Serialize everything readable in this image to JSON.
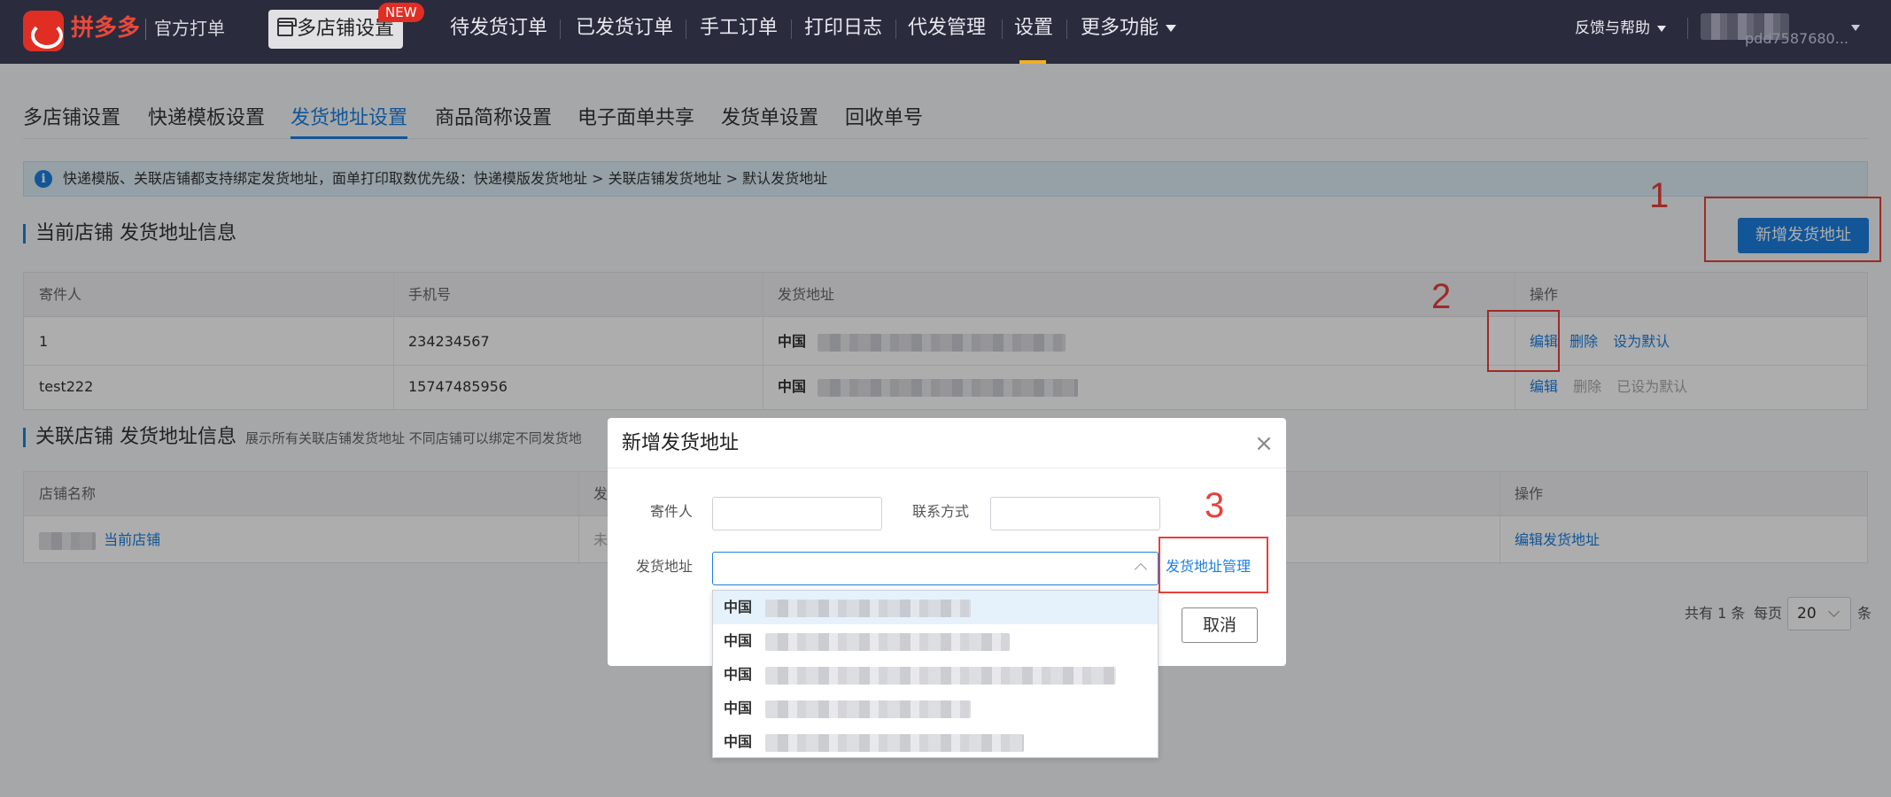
{
  "topbar": {
    "brand": "拼多多",
    "brand_sub": "官方打单",
    "active_nav": "多店铺设置",
    "new_badge": "NEW",
    "nav": [
      "待发货订单",
      "已发货订单",
      "手工订单",
      "打印日志",
      "代发管理",
      "设置"
    ],
    "more": "更多功能",
    "feedback": "反馈与帮助",
    "user_id": "pdd7587680...",
    "colors": {
      "bar": "#2a2b3d",
      "accent": "#f2b020",
      "brand": "#e02e24"
    }
  },
  "subtabs": [
    "多店铺设置",
    "快递模板设置",
    "发货地址设置",
    "商品简称设置",
    "电子面单共享",
    "发货单设置",
    "回收单号"
  ],
  "info_text": "快递模版、关联店铺都支持绑定发货地址，面单打印取数优先级：快递模版发货地址 > 关联店铺发货地址 > 默认发货地址",
  "current": {
    "title": "当前店铺 发货地址信息",
    "add_button": "新增发货地址",
    "headers": [
      "寄件人",
      "手机号",
      "发货地址",
      "操作"
    ],
    "rows": [
      {
        "sender": "1",
        "phone": "234234567",
        "country": "中国",
        "edit": "编辑",
        "delete": "删除",
        "default": "设为默认"
      },
      {
        "sender": "test222",
        "phone": "15747485956",
        "country": "中国",
        "edit": "编辑",
        "delete": "删除",
        "default": "已设为默认"
      }
    ]
  },
  "linked": {
    "title": "关联店铺 发货地址信息",
    "subtitle": "展示所有关联店铺发货地址 不同店铺可以绑定不同发货地",
    "headers": [
      "店铺名称",
      "发",
      "操作"
    ],
    "row": {
      "shop_tag": "当前店铺",
      "status": "未",
      "action": "编辑发货地址"
    }
  },
  "pagination": {
    "total": "共有 1 条",
    "per_page_label": "每页",
    "per_page": "20",
    "unit": "条"
  },
  "modal": {
    "title": "新增发货地址",
    "close": "×",
    "sender_label": "寄件人",
    "contact_label": "联系方式",
    "address_label": "发货地址",
    "manage_link": "发货地址管理",
    "cancel": "取消",
    "options": [
      "中国",
      "中国",
      "中国",
      "中国",
      "中国"
    ]
  },
  "annotations": [
    "1",
    "2",
    "3"
  ]
}
